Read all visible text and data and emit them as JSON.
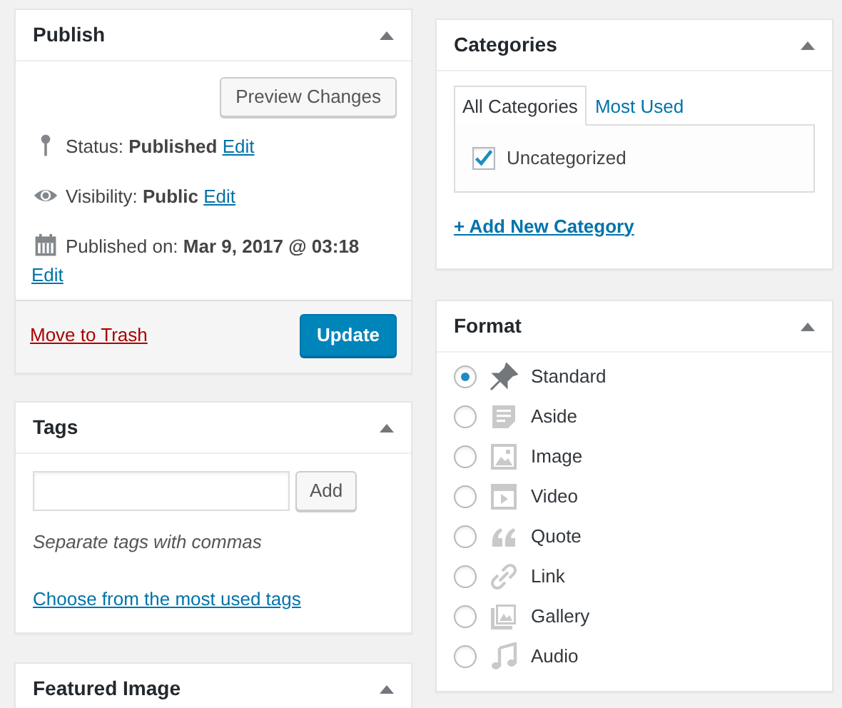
{
  "publish": {
    "title": "Publish",
    "preview_button": "Preview Changes",
    "rows": [
      {
        "kind": "status",
        "text": "Status: **Published**",
        "link": "Edit"
      },
      {
        "kind": "visibility",
        "text": "Visibility: **Public**",
        "link": "Edit"
      },
      {
        "kind": "date",
        "text": "Published on: **Mar 9, 2017 @ 03:18**",
        "link": "Edit"
      }
    ],
    "trash_link": "Move to Trash",
    "update_button": "Update"
  },
  "tags": {
    "title": "Tags",
    "add_button": "Add",
    "hint": "Separate tags with commas",
    "link": "Choose from the most used tags"
  },
  "featured_image": {
    "title": "Featured Image"
  },
  "categories": {
    "title": "Categories",
    "tabs": [
      {
        "label": "All Categories",
        "selected": true
      },
      {
        "label": "Most Used",
        "selected": false
      }
    ],
    "items": [
      {
        "label": "Uncategorized",
        "checked": true
      }
    ],
    "add_link": "+ Add New Category"
  },
  "format": {
    "title": "Format",
    "options": [
      {
        "kind": "standard",
        "label": "Standard",
        "selected": true
      },
      {
        "kind": "aside",
        "label": "Aside",
        "selected": false
      },
      {
        "kind": "image",
        "label": "Image",
        "selected": false
      },
      {
        "kind": "video",
        "label": "Video",
        "selected": false
      },
      {
        "kind": "quote",
        "label": "Quote",
        "selected": false
      },
      {
        "kind": "link",
        "label": "Link",
        "selected": false
      },
      {
        "kind": "gallery",
        "label": "Gallery",
        "selected": false
      },
      {
        "kind": "audio",
        "label": "Audio",
        "selected": false
      }
    ]
  }
}
